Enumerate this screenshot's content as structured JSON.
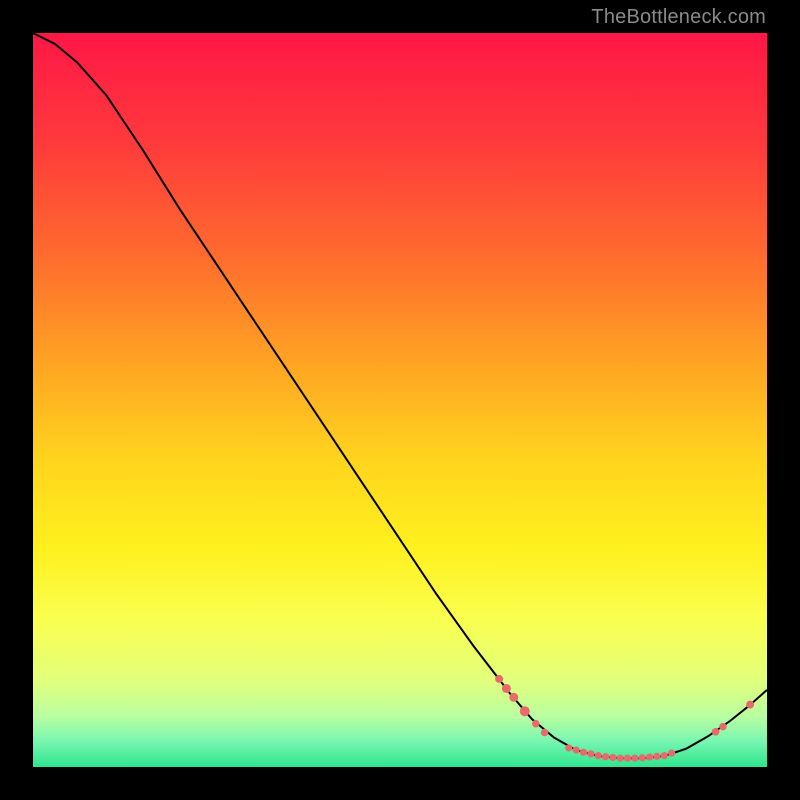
{
  "watermark": "TheBottleneck.com",
  "colors": {
    "curve_stroke": "#000000",
    "marker_fill": "#e96a6a",
    "frame_border": "#000000",
    "page_bg": "#000000",
    "watermark_text": "#8a8a8a"
  },
  "chart_data": {
    "type": "line",
    "title": "",
    "xlabel": "",
    "ylabel": "",
    "xlim": [
      0,
      100
    ],
    "ylim": [
      0,
      100
    ],
    "gradient_stops": [
      {
        "offset": 0.0,
        "color": "#ff1746"
      },
      {
        "offset": 0.15,
        "color": "#ff3a3c"
      },
      {
        "offset": 0.3,
        "color": "#ff6a2e"
      },
      {
        "offset": 0.45,
        "color": "#ffa423"
      },
      {
        "offset": 0.58,
        "color": "#ffd41e"
      },
      {
        "offset": 0.7,
        "color": "#fff01e"
      },
      {
        "offset": 0.8,
        "color": "#f9ff50"
      },
      {
        "offset": 0.88,
        "color": "#e3ff7a"
      },
      {
        "offset": 0.93,
        "color": "#baffa0"
      },
      {
        "offset": 0.965,
        "color": "#78f6b0"
      },
      {
        "offset": 1.0,
        "color": "#2de58f"
      }
    ],
    "curve": [
      {
        "x": 0.0,
        "y": 100.0
      },
      {
        "x": 3.0,
        "y": 98.5
      },
      {
        "x": 6.0,
        "y": 96.0
      },
      {
        "x": 10.0,
        "y": 91.5
      },
      {
        "x": 15.0,
        "y": 84.0
      },
      {
        "x": 20.0,
        "y": 76.0
      },
      {
        "x": 25.0,
        "y": 68.5
      },
      {
        "x": 30.0,
        "y": 61.0
      },
      {
        "x": 35.0,
        "y": 53.5
      },
      {
        "x": 40.0,
        "y": 46.0
      },
      {
        "x": 45.0,
        "y": 38.5
      },
      {
        "x": 50.0,
        "y": 31.0
      },
      {
        "x": 55.0,
        "y": 23.5
      },
      {
        "x": 60.0,
        "y": 16.5
      },
      {
        "x": 65.0,
        "y": 10.0
      },
      {
        "x": 68.0,
        "y": 6.5
      },
      {
        "x": 71.0,
        "y": 4.0
      },
      {
        "x": 74.0,
        "y": 2.3
      },
      {
        "x": 77.0,
        "y": 1.5
      },
      {
        "x": 80.0,
        "y": 1.2
      },
      {
        "x": 83.0,
        "y": 1.2
      },
      {
        "x": 86.0,
        "y": 1.5
      },
      {
        "x": 89.0,
        "y": 2.5
      },
      {
        "x": 92.0,
        "y": 4.2
      },
      {
        "x": 95.0,
        "y": 6.3
      },
      {
        "x": 97.5,
        "y": 8.3
      },
      {
        "x": 100.0,
        "y": 10.5
      }
    ],
    "markers_on_curve": [
      {
        "x": 63.5,
        "y": 12.0,
        "r": 4.0
      },
      {
        "x": 64.5,
        "y": 10.7,
        "r": 4.5
      },
      {
        "x": 65.5,
        "y": 9.5,
        "r": 4.5
      },
      {
        "x": 67.0,
        "y": 7.6,
        "r": 5.0
      },
      {
        "x": 68.5,
        "y": 5.9,
        "r": 3.8
      },
      {
        "x": 69.7,
        "y": 4.7,
        "r": 3.8
      },
      {
        "x": 73.0,
        "y": 2.6,
        "r": 3.6
      },
      {
        "x": 74.0,
        "y": 2.3,
        "r": 3.6
      },
      {
        "x": 75.0,
        "y": 2.0,
        "r": 3.6
      },
      {
        "x": 76.0,
        "y": 1.8,
        "r": 3.6
      },
      {
        "x": 77.0,
        "y": 1.55,
        "r": 3.6
      },
      {
        "x": 78.0,
        "y": 1.4,
        "r": 3.6
      },
      {
        "x": 79.0,
        "y": 1.3,
        "r": 3.6
      },
      {
        "x": 80.0,
        "y": 1.2,
        "r": 3.6
      },
      {
        "x": 81.0,
        "y": 1.2,
        "r": 3.6
      },
      {
        "x": 82.0,
        "y": 1.2,
        "r": 3.6
      },
      {
        "x": 83.0,
        "y": 1.25,
        "r": 3.6
      },
      {
        "x": 84.0,
        "y": 1.35,
        "r": 3.6
      },
      {
        "x": 85.0,
        "y": 1.45,
        "r": 3.6
      },
      {
        "x": 86.0,
        "y": 1.55,
        "r": 3.6
      },
      {
        "x": 87.0,
        "y": 1.9,
        "r": 3.6
      },
      {
        "x": 93.0,
        "y": 4.8,
        "r": 3.8
      },
      {
        "x": 94.0,
        "y": 5.5,
        "r": 3.8
      },
      {
        "x": 97.7,
        "y": 8.5,
        "r": 4.0
      }
    ]
  }
}
